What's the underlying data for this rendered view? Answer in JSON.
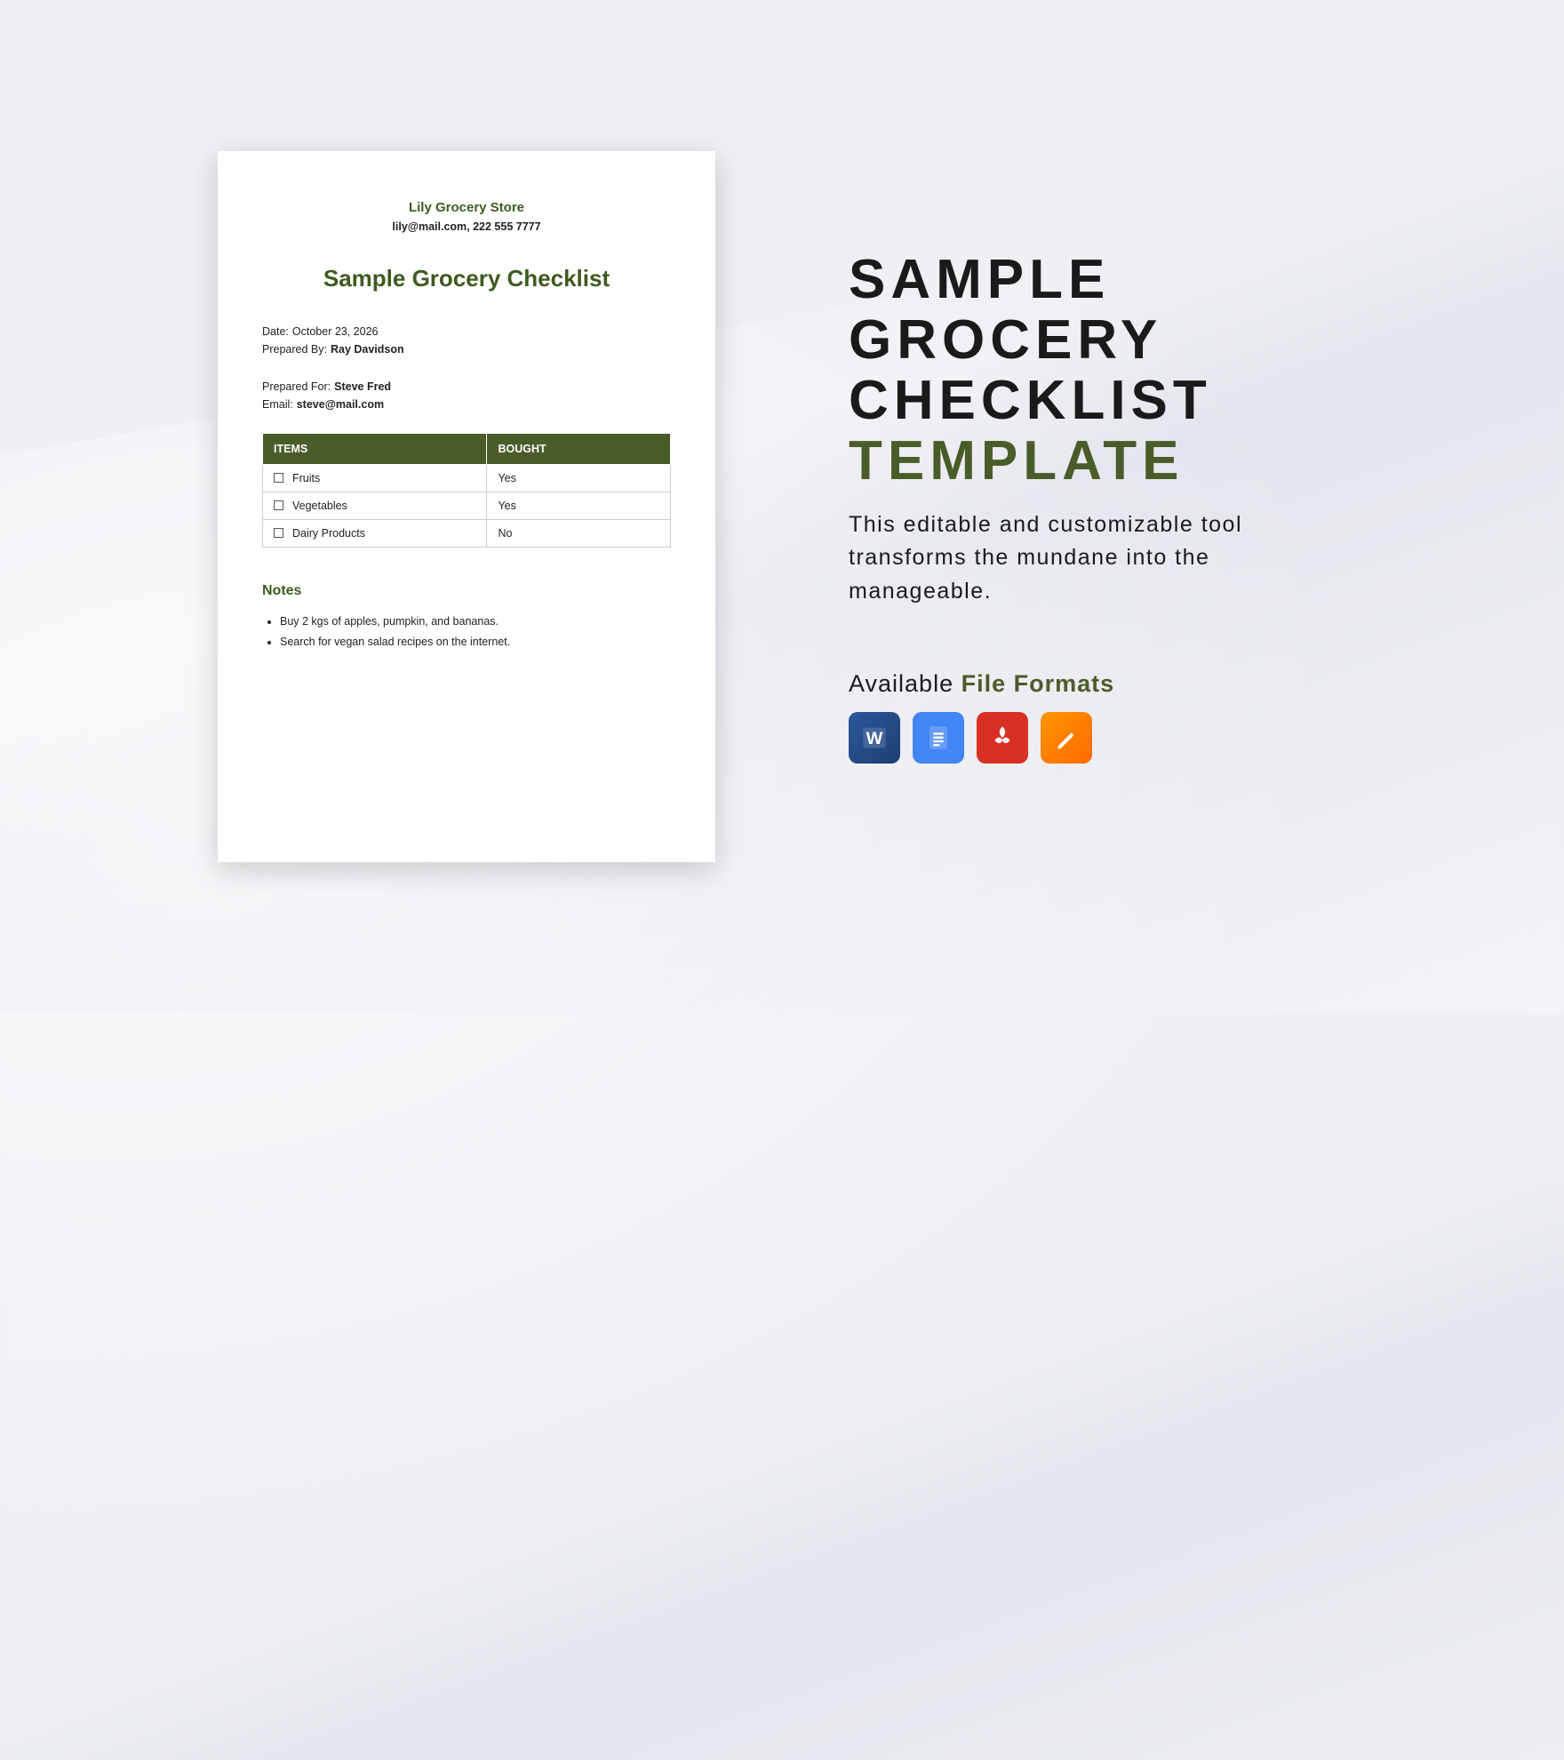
{
  "document": {
    "store_name": "Lily Grocery Store",
    "contact": "lily@mail.com, 222 555 7777",
    "title": "Sample Grocery Checklist",
    "date_label": "Date:",
    "date_value": "October 23, 2026",
    "prepared_by_label": "Prepared By:",
    "prepared_by_value": "Ray Davidson",
    "prepared_for_label": "Prepared For:",
    "prepared_for_value": "Steve Fred",
    "email_label": "Email:",
    "email_value": "steve@mail.com",
    "table": {
      "col_items": "ITEMS",
      "col_bought": "BOUGHT",
      "rows": [
        {
          "item": "Fruits",
          "bought": "Yes"
        },
        {
          "item": "Vegetables",
          "bought": "Yes"
        },
        {
          "item": "Dairy Products",
          "bought": "No"
        }
      ]
    },
    "notes_title": "Notes",
    "notes": [
      "Buy 2 kgs of apples, pumpkin, and bananas.",
      "Search for vegan salad recipes on the internet."
    ]
  },
  "promo": {
    "line1": "SAMPLE",
    "line2": "GROCERY",
    "line3": "CHECKLIST",
    "line4": "TEMPLATE",
    "subtext": "This editable and customizable tool transforms the mundane into the manageable.",
    "formats_label_pre": "Available ",
    "formats_label_bold": "File Formats",
    "formats": [
      {
        "name": "word-icon"
      },
      {
        "name": "google-docs-icon"
      },
      {
        "name": "pdf-icon"
      },
      {
        "name": "pages-icon"
      }
    ]
  }
}
